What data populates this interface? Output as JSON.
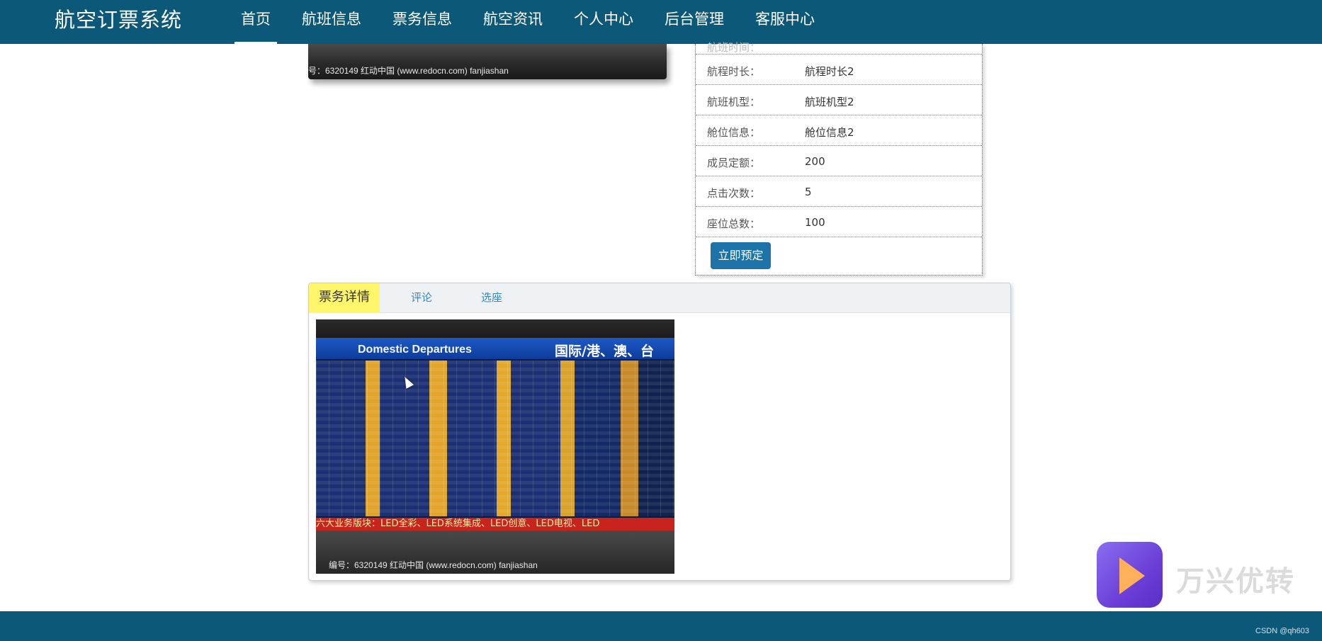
{
  "app": {
    "brand": "航空订票系统"
  },
  "nav": {
    "items": [
      {
        "label": "首页",
        "active": true
      },
      {
        "label": "航班信息"
      },
      {
        "label": "票务信息"
      },
      {
        "label": "航空资讯"
      },
      {
        "label": "个人中心"
      },
      {
        "label": "后台管理"
      },
      {
        "label": "客服中心"
      }
    ]
  },
  "top_image": {
    "caption": "号：6320149    红动中国 (www.redocn.com)    fanjiashan"
  },
  "info": {
    "partial_label": "航班时间：",
    "rows": [
      {
        "label": "航程时长：",
        "value": "航程时长2"
      },
      {
        "label": "航班机型：",
        "value": "航班机型2"
      },
      {
        "label": "舱位信息：",
        "value": "舱位信息2"
      },
      {
        "label": "成员定额：",
        "value": "200"
      },
      {
        "label": "点击次数：",
        "value": "5"
      },
      {
        "label": "座位总数：",
        "value": "100"
      }
    ],
    "book_button": "立即预定"
  },
  "detail": {
    "tabs": [
      {
        "label": "票务详情",
        "active": true
      },
      {
        "label": "评论"
      },
      {
        "label": "选座"
      }
    ],
    "board": {
      "title_en": "Domestic Departures",
      "title_cn": "国际/港、澳、台",
      "ticker": "六大业务版块：LED全彩、LED系统集成、LED创意、LED电视、LED",
      "caption": "编号：6320149    红动中国 (www.redocn.com)    fanjiashan"
    }
  },
  "footer": {
    "credit": "CSDN @qh603"
  },
  "watermark": {
    "text": "万兴优转"
  },
  "colors": {
    "nav_bg": "#0b5878",
    "button": "#1d73a8",
    "active_tab": "#fff66b",
    "tab_link": "#3a86c5"
  }
}
